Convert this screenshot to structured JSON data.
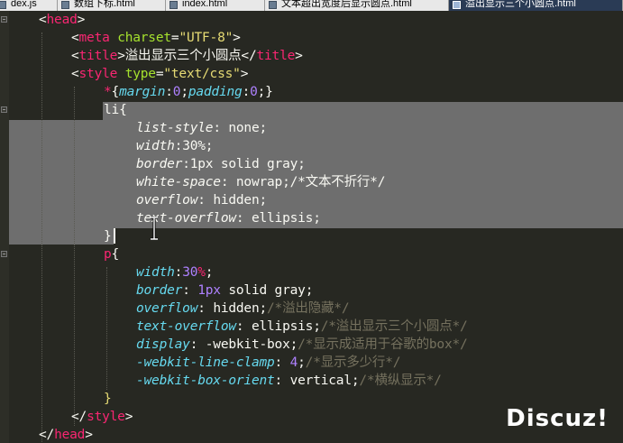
{
  "tabs": [
    {
      "label": "dex.js",
      "active": false
    },
    {
      "label": "数组下标.html",
      "active": false
    },
    {
      "label": "index.html",
      "active": false
    },
    {
      "label": "文本超出宽度后显示圆点.html",
      "active": false
    },
    {
      "label": "溢出显示三个小圆点.html",
      "active": true
    }
  ],
  "code": {
    "head_open": "head",
    "meta_tag": "meta",
    "meta_attr": "charset",
    "meta_value": "\"UTF-8\"",
    "title_tag": "title",
    "title_text": "溢出显示三个小圆点",
    "style_tag": "style",
    "style_attr": "type",
    "style_value": "\"text/css\"",
    "star": "*",
    "margin_prop": "margin",
    "padding_prop": "padding",
    "zero": "0",
    "li_selector": "li",
    "list_style_prop": "list-style",
    "list_style_value": "none",
    "width_prop": "width",
    "width_value": "30%",
    "border_prop": "border",
    "li_border_value": "1px solid gray",
    "white_space_prop": "white-space",
    "white_space_value": "nowrap",
    "white_space_comment": "/*文本不折行*/",
    "overflow_prop": "overflow",
    "overflow_value": "hidden",
    "text_overflow_prop": "text-overflow",
    "text_overflow_value": "ellipsis",
    "p_selector": "p",
    "p_width_num": "30",
    "p_width_unit": "%",
    "border_px": "1px",
    "border_rest": "solid gray",
    "p_overflow_comment": "/*溢出隐藏*/",
    "p_text_overflow_comment": "/*溢出显示三个小圆点*/",
    "display_prop": "display",
    "display_value": "-webkit-box",
    "display_comment": "/*显示成适用于谷歌的box*/",
    "line_clamp_prop": "-webkit-line-clamp",
    "line_clamp_value": "4",
    "line_clamp_comment": "/*显示多少行*/",
    "box_orient_prop": "-webkit-box-orient",
    "box_orient_value": "vertical",
    "box_orient_comment": "/*横纵显示*/",
    "style_close": "style",
    "head_close": "head"
  },
  "watermark": "Discuz!"
}
